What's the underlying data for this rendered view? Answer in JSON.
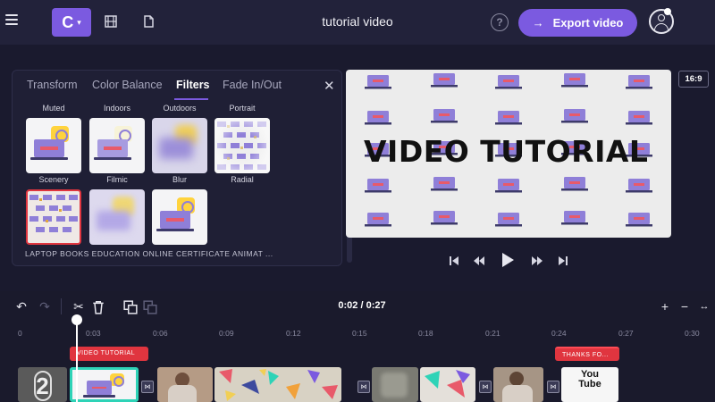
{
  "header": {
    "brand_letter": "C",
    "title": "tutorial video",
    "help_label": "?",
    "export_label": "Export video",
    "colors": {
      "accent": "#7b5ae0",
      "background": "#22223a"
    }
  },
  "filter_panel": {
    "tabs": [
      {
        "label": "Transform",
        "active": false
      },
      {
        "label": "Color Balance",
        "active": false
      },
      {
        "label": "Filters",
        "active": true
      },
      {
        "label": "Fade In/Out",
        "active": false
      }
    ],
    "close_label": "✕",
    "row1_labels": [
      "Muted",
      "Indoors",
      "Outdoors",
      "Portrait"
    ],
    "row2_labels": [
      "Scenery",
      "Filmic",
      "Blur",
      "Radial"
    ],
    "footer_text": "LAPTOP BOOKS EDUCATION ONLINE CERTIFICATE ANIMAT ..."
  },
  "preview": {
    "title_text": "VIDEO TUTORIAL",
    "aspect_ratio": "16:9"
  },
  "timeline": {
    "current_time": "0:02 / 0:27",
    "ticks": [
      "0",
      "0:03",
      "0:06",
      "0:09",
      "0:12",
      "0:15",
      "0:18",
      "0:21",
      "0:24",
      "0:27",
      "0:30"
    ],
    "text_clips": [
      "VIDEO TUTORIAL",
      "THANKS FO..."
    ],
    "clip_countdown": "2",
    "youtube_label": "You Tube",
    "colors": {
      "text_clip": "#e0353f",
      "selected_clip": "#2ed3b7"
    }
  },
  "icons": [
    "menu-icon",
    "film-icon",
    "document-icon",
    "help-icon",
    "arrow-right-icon",
    "avatar-icon",
    "close-icon",
    "skip-back-icon",
    "rewind-icon",
    "play-icon",
    "fast-forward-icon",
    "skip-forward-icon",
    "undo-icon",
    "redo-icon",
    "scissors-icon",
    "trash-icon",
    "duplicate-icon",
    "plus-icon",
    "minus-icon",
    "fit-icon"
  ]
}
